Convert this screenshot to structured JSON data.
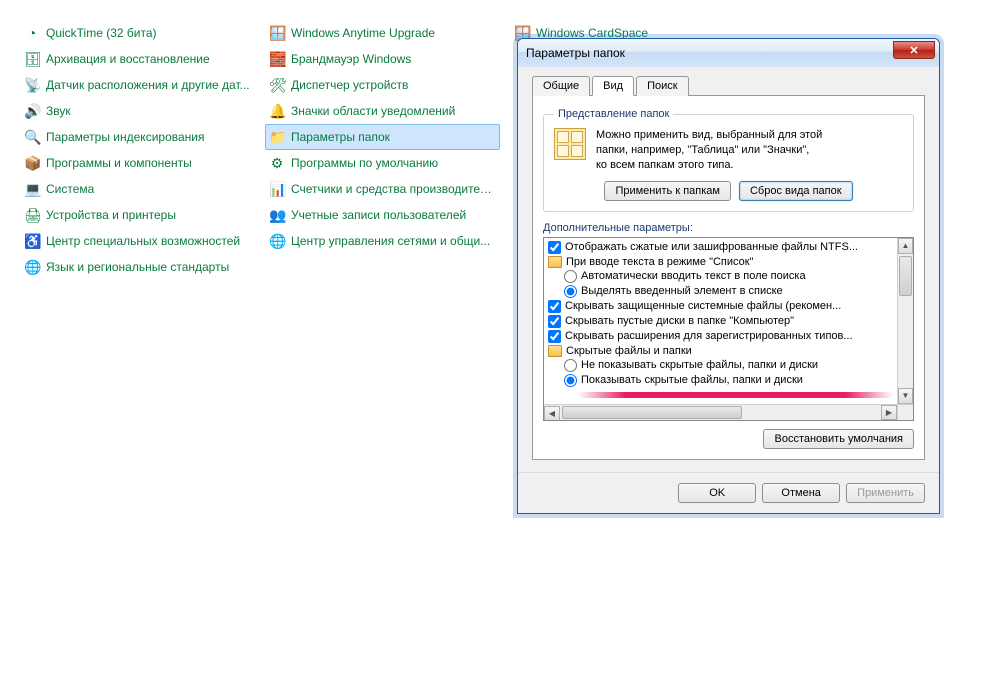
{
  "cp_columns": [
    [
      {
        "icon": "◔",
        "label": "QuickTime (32 бита)"
      },
      {
        "icon": "🗄",
        "label": "Архивация и восстановление"
      },
      {
        "icon": "📡",
        "label": "Датчик расположения и другие дат..."
      },
      {
        "icon": "🔊",
        "label": "Звук"
      },
      {
        "icon": "🔍",
        "label": "Параметры индексирования"
      },
      {
        "icon": "📦",
        "label": "Программы и компоненты"
      },
      {
        "icon": "💻",
        "label": "Система"
      },
      {
        "icon": "🖨",
        "label": "Устройства и принтеры"
      },
      {
        "icon": "♿",
        "label": "Центр специальных возможностей"
      },
      {
        "icon": "🌐",
        "label": "Язык и региональные стандарты"
      }
    ],
    [
      {
        "icon": "🪟",
        "label": "Windows Anytime Upgrade"
      },
      {
        "icon": "🧱",
        "label": "Брандмауэр Windows"
      },
      {
        "icon": "🛠",
        "label": "Диспетчер устройств"
      },
      {
        "icon": "🔔",
        "label": "Значки области уведомлений"
      },
      {
        "icon": "📁",
        "label": "Параметры папок",
        "selected": true
      },
      {
        "icon": "⚙",
        "label": "Программы по умолчанию"
      },
      {
        "icon": "📊",
        "label": "Счетчики и средства производител..."
      },
      {
        "icon": "👥",
        "label": "Учетные записи пользователей"
      },
      {
        "icon": "🌐",
        "label": "Центр управления сетями и общи..."
      }
    ],
    [
      {
        "icon": "🪟",
        "label": "Windows CardSpace"
      }
    ]
  ],
  "dialog": {
    "title": "Параметры папок",
    "tabs": [
      "Общие",
      "Вид",
      "Поиск"
    ],
    "active_tab": 1,
    "group1": {
      "legend": "Представление папок",
      "text1": "Можно применить вид, выбранный для этой",
      "text2": "папки, например, \"Таблица\" или \"Значки\",",
      "text3": "ко всем папкам этого типа.",
      "apply_btn": "Применить к папкам",
      "reset_btn": "Сброс вида папок"
    },
    "adv_label": "Дополнительные параметры:",
    "tree": [
      {
        "type": "check",
        "indent": 1,
        "checked": true,
        "label": "Отображать сжатые или зашифрованные файлы NTFS..."
      },
      {
        "type": "folder",
        "indent": 1,
        "label": "При вводе текста в режиме \"Список\""
      },
      {
        "type": "radio",
        "indent": 2,
        "checked": false,
        "label": "Автоматически вводить текст в поле поиска"
      },
      {
        "type": "radio",
        "indent": 2,
        "checked": true,
        "label": "Выделять введенный элемент в списке"
      },
      {
        "type": "check",
        "indent": 1,
        "checked": true,
        "label": "Скрывать защищенные системные файлы (рекомен..."
      },
      {
        "type": "check",
        "indent": 1,
        "checked": true,
        "label": "Скрывать пустые диски в папке \"Компьютер\""
      },
      {
        "type": "check",
        "indent": 1,
        "checked": true,
        "label": "Скрывать расширения для зарегистрированных типов..."
      },
      {
        "type": "folder",
        "indent": 1,
        "label": "Скрытые файлы и папки"
      },
      {
        "type": "radio",
        "indent": 2,
        "checked": false,
        "label": "Не показывать скрытые файлы, папки и диски"
      },
      {
        "type": "radio",
        "indent": 2,
        "checked": true,
        "label": "Показывать скрытые файлы, папки и диски"
      }
    ],
    "restore_btn": "Восстановить умолчания",
    "ok": "OK",
    "cancel": "Отмена",
    "apply": "Применить"
  }
}
